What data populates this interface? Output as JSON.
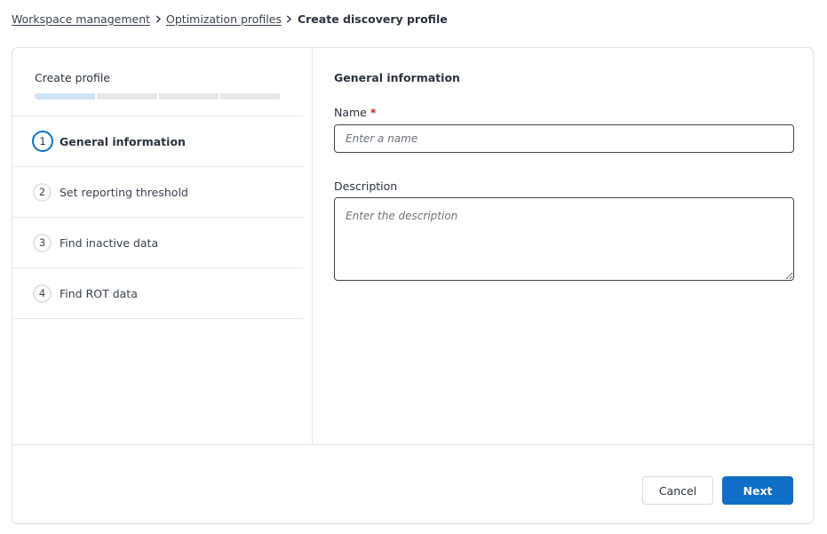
{
  "breadcrumb": {
    "items": [
      {
        "label": "Workspace management"
      },
      {
        "label": "Optimization profiles"
      }
    ],
    "current": "Create discovery profile"
  },
  "wizard": {
    "title": "Create profile",
    "progress": {
      "total_steps": 4,
      "current_step": 1
    },
    "steps": [
      {
        "number": "1",
        "label": "General information",
        "active": true
      },
      {
        "number": "2",
        "label": "Set reporting threshold",
        "active": false
      },
      {
        "number": "3",
        "label": "Find inactive data",
        "active": false
      },
      {
        "number": "4",
        "label": "Find ROT data",
        "active": false
      }
    ]
  },
  "form": {
    "section_title": "General information",
    "name": {
      "label": "Name",
      "required_marker": "*",
      "value": "",
      "placeholder": "Enter a name"
    },
    "description": {
      "label": "Description",
      "value": "",
      "placeholder": "Enter the description"
    }
  },
  "footer": {
    "cancel_label": "Cancel",
    "next_label": "Next"
  },
  "colors": {
    "primary": "#0f6fc6",
    "progress_active": "#cfe3f7",
    "progress_inactive": "#e5e6e8",
    "required": "#c0282d"
  },
  "icons": {
    "breadcrumb_separator": "chevron-right-icon"
  }
}
